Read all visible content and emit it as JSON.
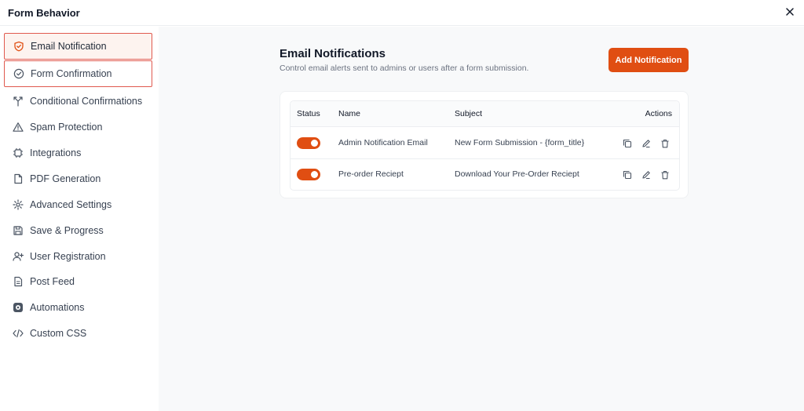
{
  "window": {
    "title": "Form Behavior"
  },
  "sidebar": {
    "items": [
      {
        "label": "Email Notification",
        "icon": "shield-icon"
      },
      {
        "label": "Form Confirmation",
        "icon": "check-circle-icon"
      },
      {
        "label": "Conditional Confirmations",
        "icon": "branch-icon"
      },
      {
        "label": "Spam Protection",
        "icon": "warning-triangle-icon"
      },
      {
        "label": "Integrations",
        "icon": "chip-icon"
      },
      {
        "label": "PDF Generation",
        "icon": "document-icon"
      },
      {
        "label": "Advanced Settings",
        "icon": "gear-icon"
      },
      {
        "label": "Save & Progress",
        "icon": "save-icon"
      },
      {
        "label": "User Registration",
        "icon": "user-plus-icon"
      },
      {
        "label": "Post Feed",
        "icon": "file-text-icon"
      },
      {
        "label": "Automations",
        "icon": "automation-icon"
      },
      {
        "label": "Custom CSS",
        "icon": "code-icon"
      }
    ]
  },
  "main": {
    "title": "Email Notifications",
    "subtitle": "Control email alerts sent to admins or users after a form submission.",
    "add_button": "Add Notification",
    "table": {
      "headers": {
        "status": "Status",
        "name": "Name",
        "subject": "Subject",
        "actions": "Actions"
      },
      "rows": [
        {
          "enabled": true,
          "name": "Admin Notification Email",
          "subject": "New Form Submission - {form_title}"
        },
        {
          "enabled": true,
          "name": "Pre-order Reciept",
          "subject": "Download Your Pre-Order Reciept"
        }
      ]
    }
  },
  "colors": {
    "accent": "#e04e12",
    "highlight_border": "#e05a4f"
  }
}
